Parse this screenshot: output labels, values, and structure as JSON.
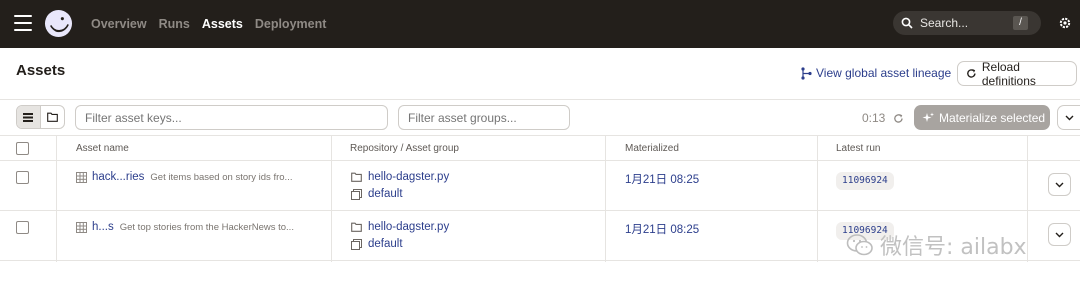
{
  "topnav": {
    "items": [
      {
        "label": "Overview",
        "active": false
      },
      {
        "label": "Runs",
        "active": false
      },
      {
        "label": "Assets",
        "active": true
      },
      {
        "label": "Deployment",
        "active": false
      }
    ],
    "search_placeholder": "Search...",
    "search_shortcut": "/"
  },
  "page": {
    "title": "Assets",
    "lineage_link": "View global asset lineage",
    "reload_button": "Reload definitions"
  },
  "toolbar": {
    "filter_keys_placeholder": "Filter asset keys...",
    "filter_groups_placeholder": "Filter asset groups...",
    "refresh_timer": "0:13",
    "materialize_button": "Materialize selected"
  },
  "table": {
    "columns": [
      "Asset name",
      "Repository / Asset group",
      "Materialized",
      "Latest run"
    ],
    "rows": [
      {
        "name": "hack...ries",
        "description": "Get items based on story ids fro...",
        "repository": "hello-dagster.py",
        "group": "default",
        "materialized": "1月21日 08:25",
        "latest_run": "11096924"
      },
      {
        "name": "h...s",
        "description": "Get top stories from the HackerNews to...",
        "repository": "hello-dagster.py",
        "group": "default",
        "materialized": "1月21日 08:25",
        "latest_run": "11096924"
      }
    ]
  },
  "watermark": "微信号: ailabx",
  "colors": {
    "topbar_bg": "#231f1b",
    "link": "#2c3e8c",
    "button_disabled": "#a8a4a0",
    "border": "#e6e4e1"
  }
}
